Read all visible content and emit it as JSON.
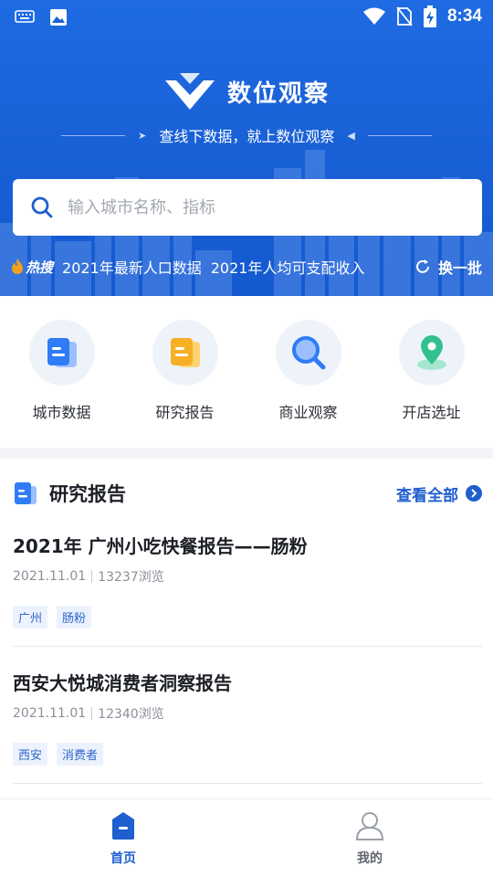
{
  "status_bar": {
    "time": "8:34"
  },
  "header": {
    "brand": "数位观察",
    "slogan": "查线下数据，就上数位观察"
  },
  "search": {
    "placeholder": "输入城市名称、指标"
  },
  "hot": {
    "badge": "热搜",
    "items": [
      "2021年最新人口数据",
      "2021年人均可支配收入"
    ],
    "refresh_label": "换一批"
  },
  "quick_nav": [
    {
      "label": "城市数据",
      "icon": "city-data-icon"
    },
    {
      "label": "研究报告",
      "icon": "research-report-icon"
    },
    {
      "label": "商业观察",
      "icon": "magnifier-icon"
    },
    {
      "label": "开店选址",
      "icon": "location-pin-icon"
    }
  ],
  "reports": {
    "section_title": "研究报告",
    "view_all": "查看全部",
    "items": [
      {
        "title": "2021年 广州小吃快餐报告——肠粉",
        "date": "2021.11.01",
        "views": "13237浏览",
        "tags": [
          "广州",
          "肠粉"
        ]
      },
      {
        "title": "西安大悦城消费者洞察报告",
        "date": "2021.11.01",
        "views": "12340浏览",
        "tags": [
          "西安",
          "消费者"
        ]
      }
    ]
  },
  "tabbar": [
    {
      "label": "首页",
      "active": true
    },
    {
      "label": "我的",
      "active": false
    }
  ],
  "colors": {
    "primary": "#1f5fcf",
    "hero": "#1a62d8"
  }
}
